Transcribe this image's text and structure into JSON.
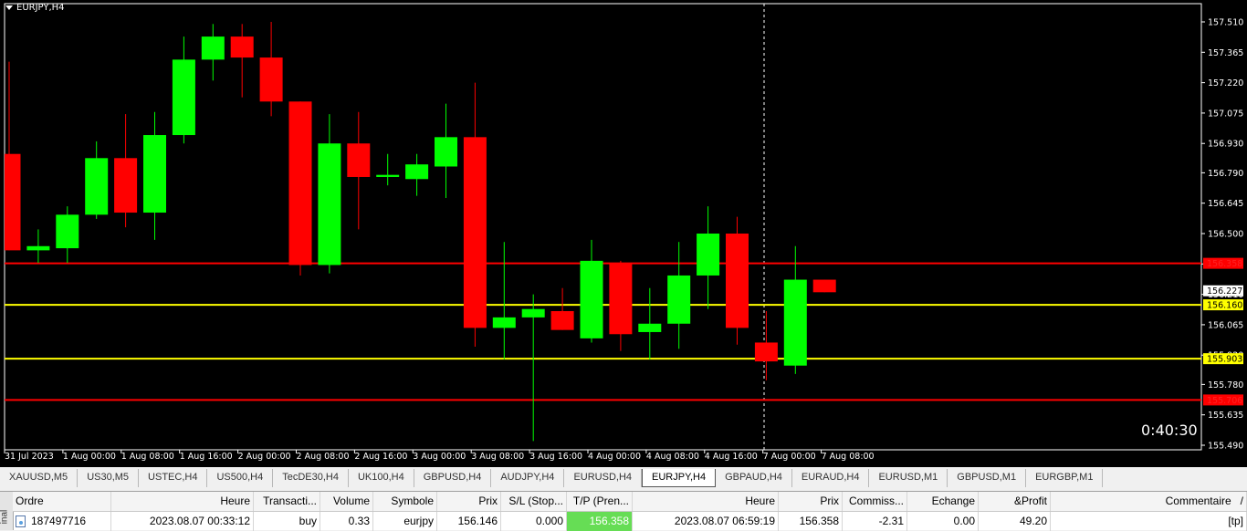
{
  "chart": {
    "symbol": "EURJPY,H4",
    "timer": "0:40:30",
    "colors": {
      "bull": "#00ff00",
      "bear": "#ff0000",
      "wick": "#00ff00",
      "axis_text": "#ffffff",
      "background": "#000000"
    },
    "price_levels": [
      "157.510",
      "157.365",
      "157.220",
      "157.075",
      "156.930",
      "156.790",
      "156.645",
      "156.500",
      "156.355",
      "156.210",
      "156.065",
      "155.920",
      "155.780",
      "155.635",
      "155.490"
    ],
    "time_labels": [
      "31 Jul 2023",
      "1 Aug 00:00",
      "1 Aug 08:00",
      "1 Aug 16:00",
      "2 Aug 00:00",
      "2 Aug 08:00",
      "2 Aug 16:00",
      "3 Aug 00:00",
      "3 Aug 08:00",
      "3 Aug 16:00",
      "4 Aug 00:00",
      "4 Aug 08:00",
      "4 Aug 16:00",
      "7 Aug 00:00",
      "7 Aug 08:00"
    ],
    "tagged_levels": [
      {
        "value": "156.358",
        "color": "#ff0000",
        "text_color": "#ff2222",
        "tag_bg": "#ff0000"
      },
      {
        "value": "156.160",
        "color": "#ffff00",
        "text_color": "#000000",
        "tag_bg": "#ffff00"
      },
      {
        "value": "155.903",
        "color": "#ffff00",
        "text_color": "#000000",
        "tag_bg": "#ffff00"
      },
      {
        "value": "155.706",
        "color": "#ff0000",
        "text_color": "#ff2222",
        "tag_bg": "#ff0000"
      }
    ],
    "current_price": "156.227",
    "candles": [
      {
        "o": 156.88,
        "h": 157.32,
        "l": 156.42,
        "c": 156.42
      },
      {
        "o": 156.42,
        "h": 156.52,
        "l": 156.36,
        "c": 156.44
      },
      {
        "o": 156.43,
        "h": 156.63,
        "l": 156.36,
        "c": 156.59
      },
      {
        "o": 156.59,
        "h": 156.94,
        "l": 156.57,
        "c": 156.86
      },
      {
        "o": 156.86,
        "h": 157.07,
        "l": 156.53,
        "c": 156.6
      },
      {
        "o": 156.6,
        "h": 157.08,
        "l": 156.47,
        "c": 156.97
      },
      {
        "o": 156.97,
        "h": 157.44,
        "l": 156.93,
        "c": 157.33
      },
      {
        "o": 157.33,
        "h": 157.5,
        "l": 157.23,
        "c": 157.44
      },
      {
        "o": 157.44,
        "h": 157.5,
        "l": 157.15,
        "c": 157.34
      },
      {
        "o": 157.34,
        "h": 157.51,
        "l": 157.06,
        "c": 157.13
      },
      {
        "o": 157.13,
        "h": 157.13,
        "l": 156.3,
        "c": 156.35
      },
      {
        "o": 156.35,
        "h": 157.07,
        "l": 156.31,
        "c": 156.93
      },
      {
        "o": 156.93,
        "h": 157.08,
        "l": 156.52,
        "c": 156.77
      },
      {
        "o": 156.77,
        "h": 156.88,
        "l": 156.73,
        "c": 156.78
      },
      {
        "o": 156.76,
        "h": 156.88,
        "l": 156.68,
        "c": 156.83
      },
      {
        "o": 156.82,
        "h": 157.12,
        "l": 156.67,
        "c": 156.96
      },
      {
        "o": 156.96,
        "h": 157.22,
        "l": 155.96,
        "c": 156.05
      },
      {
        "o": 156.05,
        "h": 156.46,
        "l": 155.9,
        "c": 156.1
      },
      {
        "o": 156.1,
        "h": 156.21,
        "l": 155.51,
        "c": 156.14
      },
      {
        "o": 156.13,
        "h": 156.24,
        "l": 156.04,
        "c": 156.04
      },
      {
        "o": 156.0,
        "h": 156.47,
        "l": 155.98,
        "c": 156.37
      },
      {
        "o": 156.36,
        "h": 156.37,
        "l": 155.94,
        "c": 156.02
      },
      {
        "o": 156.03,
        "h": 156.24,
        "l": 155.9,
        "c": 156.07
      },
      {
        "o": 156.07,
        "h": 156.46,
        "l": 155.95,
        "c": 156.3
      },
      {
        "o": 156.3,
        "h": 156.63,
        "l": 156.14,
        "c": 156.5
      },
      {
        "o": 156.5,
        "h": 156.58,
        "l": 155.97,
        "c": 156.05
      },
      {
        "o": 155.98,
        "h": 156.13,
        "l": 155.8,
        "c": 155.89
      },
      {
        "o": 155.87,
        "h": 156.44,
        "l": 155.83,
        "c": 156.28
      },
      {
        "o": 156.28,
        "h": 156.28,
        "l": 156.22,
        "c": 156.22
      }
    ]
  },
  "tabs": [
    "XAUUSD,M5",
    "US30,M5",
    "USTEC,H4",
    "US500,H4",
    "TecDE30,H4",
    "UK100,H4",
    "GBPUSD,H4",
    "AUDJPY,H4",
    "EURUSD,H4",
    "EURJPY,H4",
    "GBPAUD,H4",
    "EURAUD,H4",
    "EURUSD,M1",
    "GBPUSD,M1",
    "EURGBP,M1"
  ],
  "active_tab": "EURJPY,H4",
  "terminal": {
    "side_label": "inal",
    "headers": [
      "Ordre",
      "Heure",
      "Transacti...",
      "Volume",
      "Symbole",
      "Prix",
      "S/L (Stop...",
      "T/P (Pren...",
      "Heure",
      "Prix",
      "Commiss...",
      "Echange",
      "&Profit",
      "Commentaire"
    ],
    "sort_arrow": "/",
    "row": [
      "187497716",
      "2023.08.07 00:33:12",
      "buy",
      "0.33",
      "eurjpy",
      "156.146",
      "0.000",
      "156.358",
      "2023.08.07 06:59:19",
      "156.358",
      "-2.31",
      "0.00",
      "49.20",
      "[tp]"
    ]
  }
}
